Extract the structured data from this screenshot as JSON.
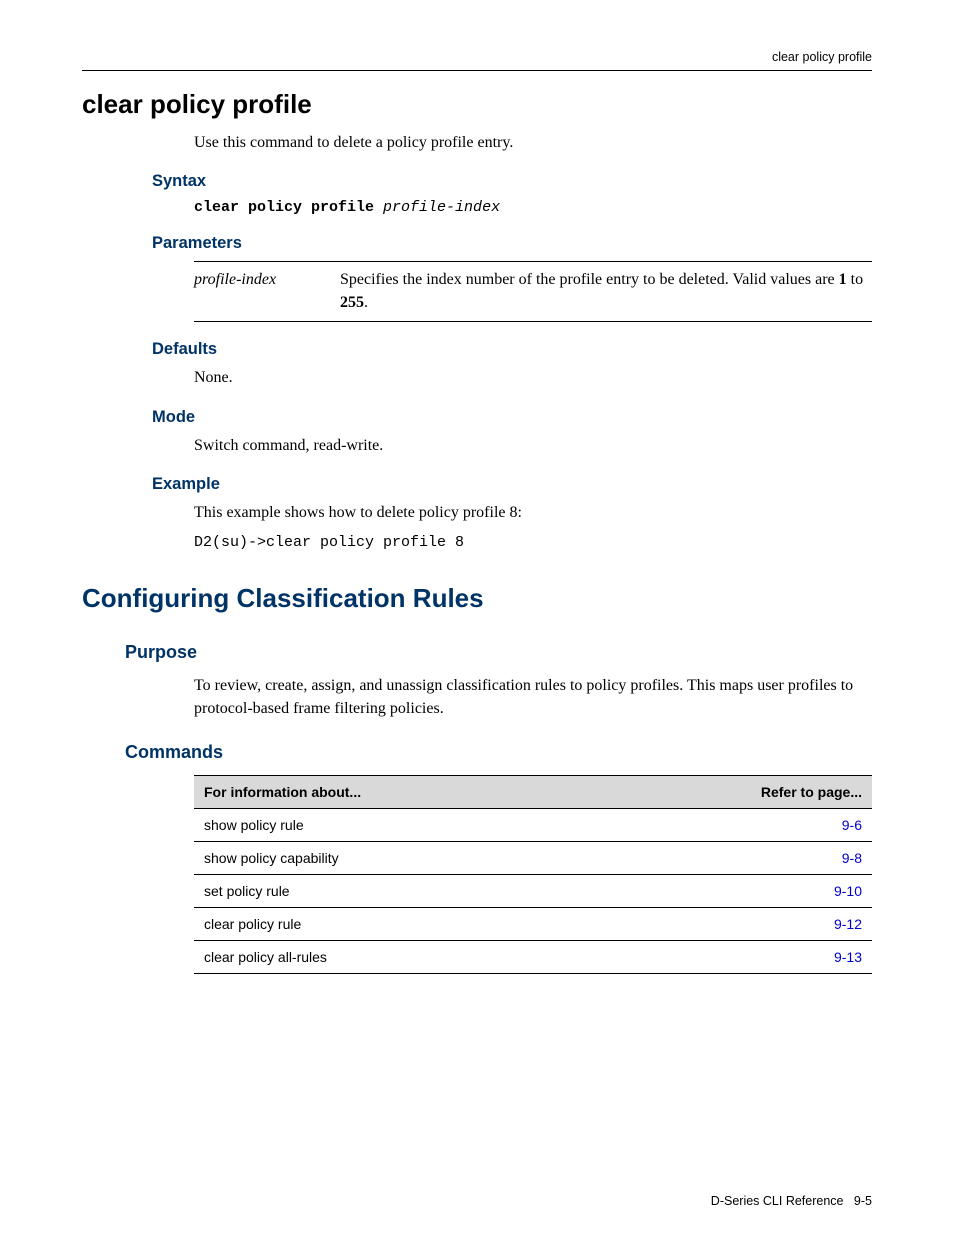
{
  "header": {
    "running_title": "clear policy profile"
  },
  "command": {
    "title": "clear policy profile",
    "intro": "Use this command to delete a policy profile entry."
  },
  "syntax": {
    "label": "Syntax",
    "cmd": "clear policy profile",
    "arg": "profile-index"
  },
  "parameters": {
    "label": "Parameters",
    "rows": [
      {
        "name": "profile-index",
        "desc_pre": "Specifies the index number of the profile entry to be deleted. Valid values are ",
        "desc_b1": "1",
        "desc_mid": " to ",
        "desc_b2": "255",
        "desc_post": "."
      }
    ]
  },
  "defaults": {
    "label": "Defaults",
    "text": "None."
  },
  "mode": {
    "label": "Mode",
    "text": "Switch command, read-write."
  },
  "example": {
    "label": "Example",
    "intro": "This example shows how to delete policy profile 8:",
    "code": "D2(su)->clear policy profile 8"
  },
  "section2": {
    "title": "Configuring Classification Rules",
    "purpose_label": "Purpose",
    "purpose_text": "To review, create, assign, and unassign classification rules to policy profiles. This maps user profiles to protocol-based frame filtering policies.",
    "commands_label": "Commands",
    "table": {
      "header1": "For information about...",
      "header2": "Refer to page...",
      "rows": [
        {
          "name": "show policy rule",
          "page": "9-6"
        },
        {
          "name": "show policy capability",
          "page": "9-8"
        },
        {
          "name": "set policy rule",
          "page": "9-10"
        },
        {
          "name": "clear policy rule",
          "page": "9-12"
        },
        {
          "name": "clear policy all-rules",
          "page": "9-13"
        }
      ]
    }
  },
  "footer": {
    "doc": "D-Series CLI Reference",
    "page": "9-5"
  }
}
